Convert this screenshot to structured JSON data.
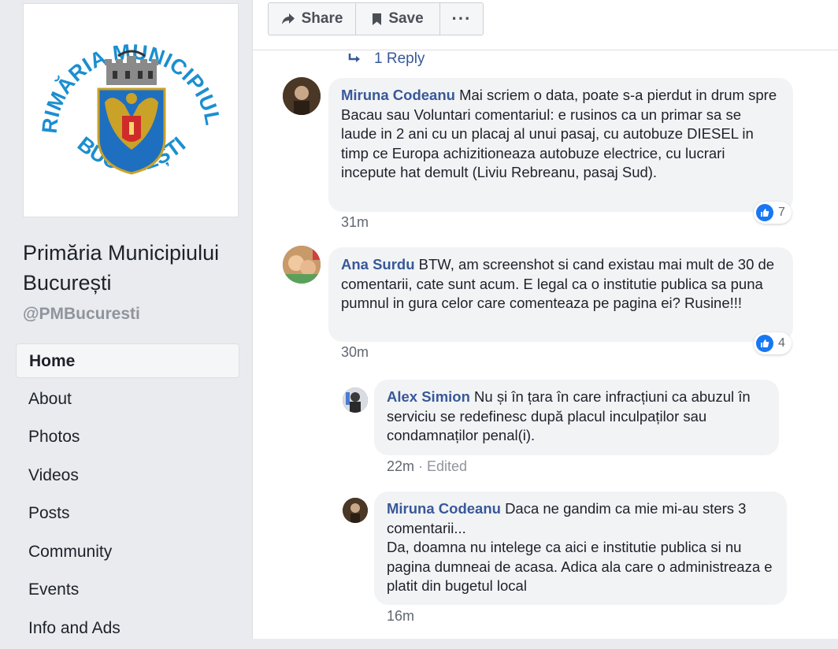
{
  "sidebar": {
    "logo_text_top": "PRIMĂRIA MUNICIPIULUI",
    "logo_text_bottom": "BUCUREȘTI",
    "page_name": "Primăria Municipiului București",
    "handle": "@PMBucuresti",
    "nav_items": [
      {
        "label": "Home",
        "active": true
      },
      {
        "label": "About"
      },
      {
        "label": "Photos"
      },
      {
        "label": "Videos"
      },
      {
        "label": "Posts"
      },
      {
        "label": "Community"
      },
      {
        "label": "Events"
      },
      {
        "label": "Info and Ads"
      }
    ]
  },
  "toolbar": {
    "share_label": "Share",
    "save_label": "Save",
    "more_label": "···"
  },
  "thread": {
    "reply_link": "1 Reply",
    "comments": [
      {
        "author": "Miruna Codeanu",
        "text": "Mai scriem o data, poate s-a pierdut in drum spre Bacau sau Voluntari comentariul: e rusinos ca un primar sa se laude in 2 ani cu un placaj al unui pasaj, cu autobuze DIESEL in timp ce Europa achizitioneaza autobuze electrice, cu lucrari incepute hat demult (Liviu Rebreanu, pasaj Sud).",
        "time": "31m",
        "likes": "7"
      },
      {
        "author": "Ana Surdu",
        "text": "BTW, am screenshot si cand existau mai mult de 30 de comentarii, cate sunt acum. E legal ca o institutie publica sa puna pumnul in gura celor care comenteaza pe pagina ei? Rusine!!!",
        "time": "30m",
        "likes": "4"
      },
      {
        "author": "Alex Simion",
        "text": "Nu și în țara în care infracțiuni ca abuzul în serviciu se redefinesc după placul inculpaților sau condamnaților penal(i).",
        "time": "22m",
        "edited": "Edited"
      },
      {
        "author": "Miruna Codeanu",
        "text_line1": "Daca ne gandim ca mie mi-au sters 3 comentarii...",
        "text_line2": "Da, doamna nu intelege ca aici e institutie publica si nu pagina dumneai de acasa. Adica ala care o administreaza e platit din bugetul local",
        "time": "16m"
      }
    ]
  },
  "colors": {
    "link_blue": "#385898",
    "logo_blue": "#1b8fd0",
    "like_blue": "#1877f2",
    "bubble_bg": "#f2f3f5"
  }
}
